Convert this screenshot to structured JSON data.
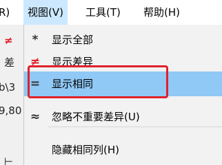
{
  "menubar": {
    "items": [
      {
        "label": "R)"
      },
      {
        "label": "视图(V)"
      },
      {
        "label": "工具(T)"
      },
      {
        "label": "帮助(H)"
      }
    ]
  },
  "background_fragments": [
    "≠",
    "差",
    "b\\3",
    "9,80",
    "⊢"
  ],
  "view_menu": {
    "items": [
      {
        "icon": "*",
        "label": "显示全部"
      },
      {
        "icon": "≠",
        "label": "显示差异"
      },
      {
        "icon": "=",
        "label": "显示相同"
      },
      {
        "icon": "≈",
        "label": "忽略不重要差异(U)"
      },
      {
        "icon": "",
        "label": "隐藏相同列(H)"
      }
    ]
  },
  "annotation": {
    "color": "#e0202a"
  }
}
